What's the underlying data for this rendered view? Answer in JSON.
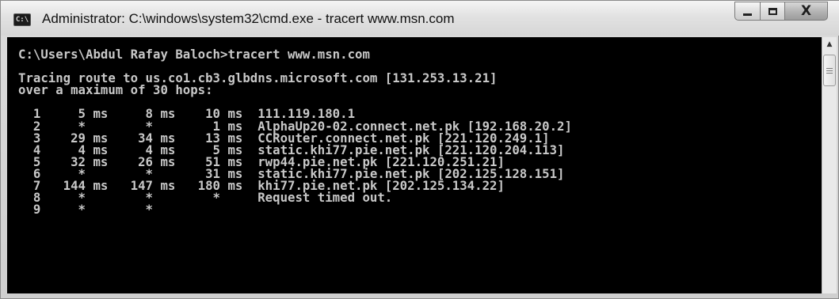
{
  "window": {
    "icon_label": "C:\\",
    "title": "Administrator: C:\\windows\\system32\\cmd.exe - tracert  www.msn.com",
    "buttons": {
      "minimize_icon": "minimize-icon",
      "maximize_icon": "maximize-icon",
      "close_glyph": "X"
    }
  },
  "console": {
    "command_line": "C:\\Users\\Abdul Rafay Baloch>tracert www.msn.com",
    "header_1": "Tracing route to us.co1.cb3.glbdns.microsoft.com [131.253.13.21]",
    "header_2": "over a maximum of 30 hops:",
    "hops": [
      "  1     5 ms     8 ms    10 ms  111.119.180.1",
      "  2     *        *        1 ms  AlphaUp20-02.connect.net.pk [192.168.20.2]",
      "  3    29 ms    34 ms    13 ms  CCRouter.connect.net.pk [221.120.249.1]",
      "  4     4 ms     4 ms     5 ms  static.khi77.pie.net.pk [221.120.204.113]",
      "  5    32 ms    26 ms    51 ms  rwp44.pie.net.pk [221.120.251.21]",
      "  6     *        *       31 ms  static.khi77.pie.net.pk [202.125.128.151]",
      "  7   144 ms   147 ms   180 ms  khi77.pie.net.pk [202.125.134.22]",
      "  8     *        *        *     Request timed out.",
      "  9     *        *"
    ]
  },
  "scrollbar": {
    "up_arrow": "▲"
  },
  "colors": {
    "console_bg": "#000000",
    "console_text": "#c8c8c8"
  }
}
